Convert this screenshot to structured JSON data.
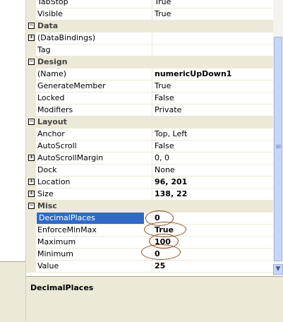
{
  "properties": [
    {
      "kind": "prop",
      "name": "TabStop",
      "value": "True"
    },
    {
      "kind": "prop",
      "name": "Visible",
      "value": "True"
    },
    {
      "kind": "cat",
      "name": "Data"
    },
    {
      "kind": "prop",
      "name": "(DataBindings)",
      "value": "",
      "expandable": true
    },
    {
      "kind": "prop",
      "name": "Tag",
      "value": ""
    },
    {
      "kind": "cat",
      "name": "Design"
    },
    {
      "kind": "prop",
      "name": "(Name)",
      "value": "numericUpDown1",
      "bold": true
    },
    {
      "kind": "prop",
      "name": "GenerateMember",
      "value": "True"
    },
    {
      "kind": "prop",
      "name": "Locked",
      "value": "False"
    },
    {
      "kind": "prop",
      "name": "Modifiers",
      "value": "Private"
    },
    {
      "kind": "cat",
      "name": "Layout"
    },
    {
      "kind": "prop",
      "name": "Anchor",
      "value": "Top, Left"
    },
    {
      "kind": "prop",
      "name": "AutoScroll",
      "value": "False"
    },
    {
      "kind": "prop",
      "name": "AutoScrollMargin",
      "value": "0, 0",
      "expandable": true
    },
    {
      "kind": "prop",
      "name": "Dock",
      "value": "None"
    },
    {
      "kind": "prop",
      "name": "Location",
      "value": "96, 201",
      "bold": true,
      "expandable": true
    },
    {
      "kind": "prop",
      "name": "Size",
      "value": "138, 22",
      "bold": true,
      "expandable": true
    },
    {
      "kind": "cat",
      "name": "Misc"
    },
    {
      "kind": "prop",
      "name": "DecimalPlaces",
      "value": "0",
      "bold": true,
      "selected": true
    },
    {
      "kind": "prop",
      "name": "EnforceMinMax",
      "value": "True",
      "bold": true
    },
    {
      "kind": "prop",
      "name": "Maximum",
      "value": "100",
      "bold": true
    },
    {
      "kind": "prop",
      "name": "Minimum",
      "value": "0",
      "bold": true
    },
    {
      "kind": "prop",
      "name": "Value",
      "value": "25",
      "bold": true
    }
  ],
  "description": {
    "title": "DecimalPlaces"
  },
  "glyphs": {
    "collapse": "−",
    "expand": "+",
    "scroll_down": "▼"
  },
  "colors": {
    "selection": "#316ac5",
    "category_bg": "#ece9d8",
    "annotation": "#8b4c1e"
  }
}
